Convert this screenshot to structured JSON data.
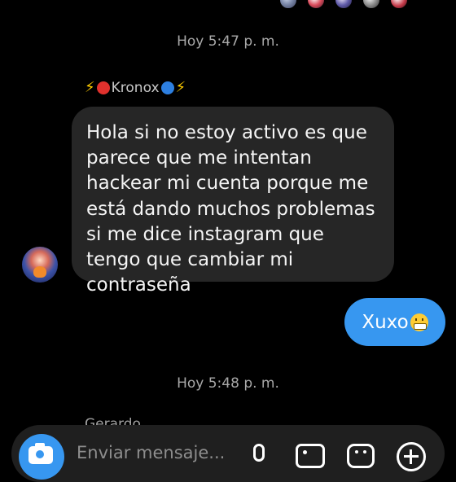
{
  "chat": {
    "timestamp_1": "Hoy 5:47 p. m.",
    "timestamp_2": "Hoy 5:48 p. m.",
    "sender": {
      "prefix_icon": "lightning-bolt-emoji",
      "name": "Kronox",
      "suffix_icon": "lightning-bolt-emoji"
    },
    "received_message": "Hola si no estoy activo es que parece que me intentan hackear mi cuenta porque me está dando muchos problemas si me dice instagram que tengo que cambiar mi contraseña",
    "sent_message": {
      "text": "Xuxo",
      "emoji": "grimacing-face-emoji"
    },
    "next_sender_partial": "Gerardo…"
  },
  "composer": {
    "placeholder": "Enviar mensaje..."
  },
  "colors": {
    "background": "#000000",
    "received_bubble": "#262626",
    "sent_bubble": "#3797f0",
    "timestamp_text": "#a8a8a8"
  }
}
